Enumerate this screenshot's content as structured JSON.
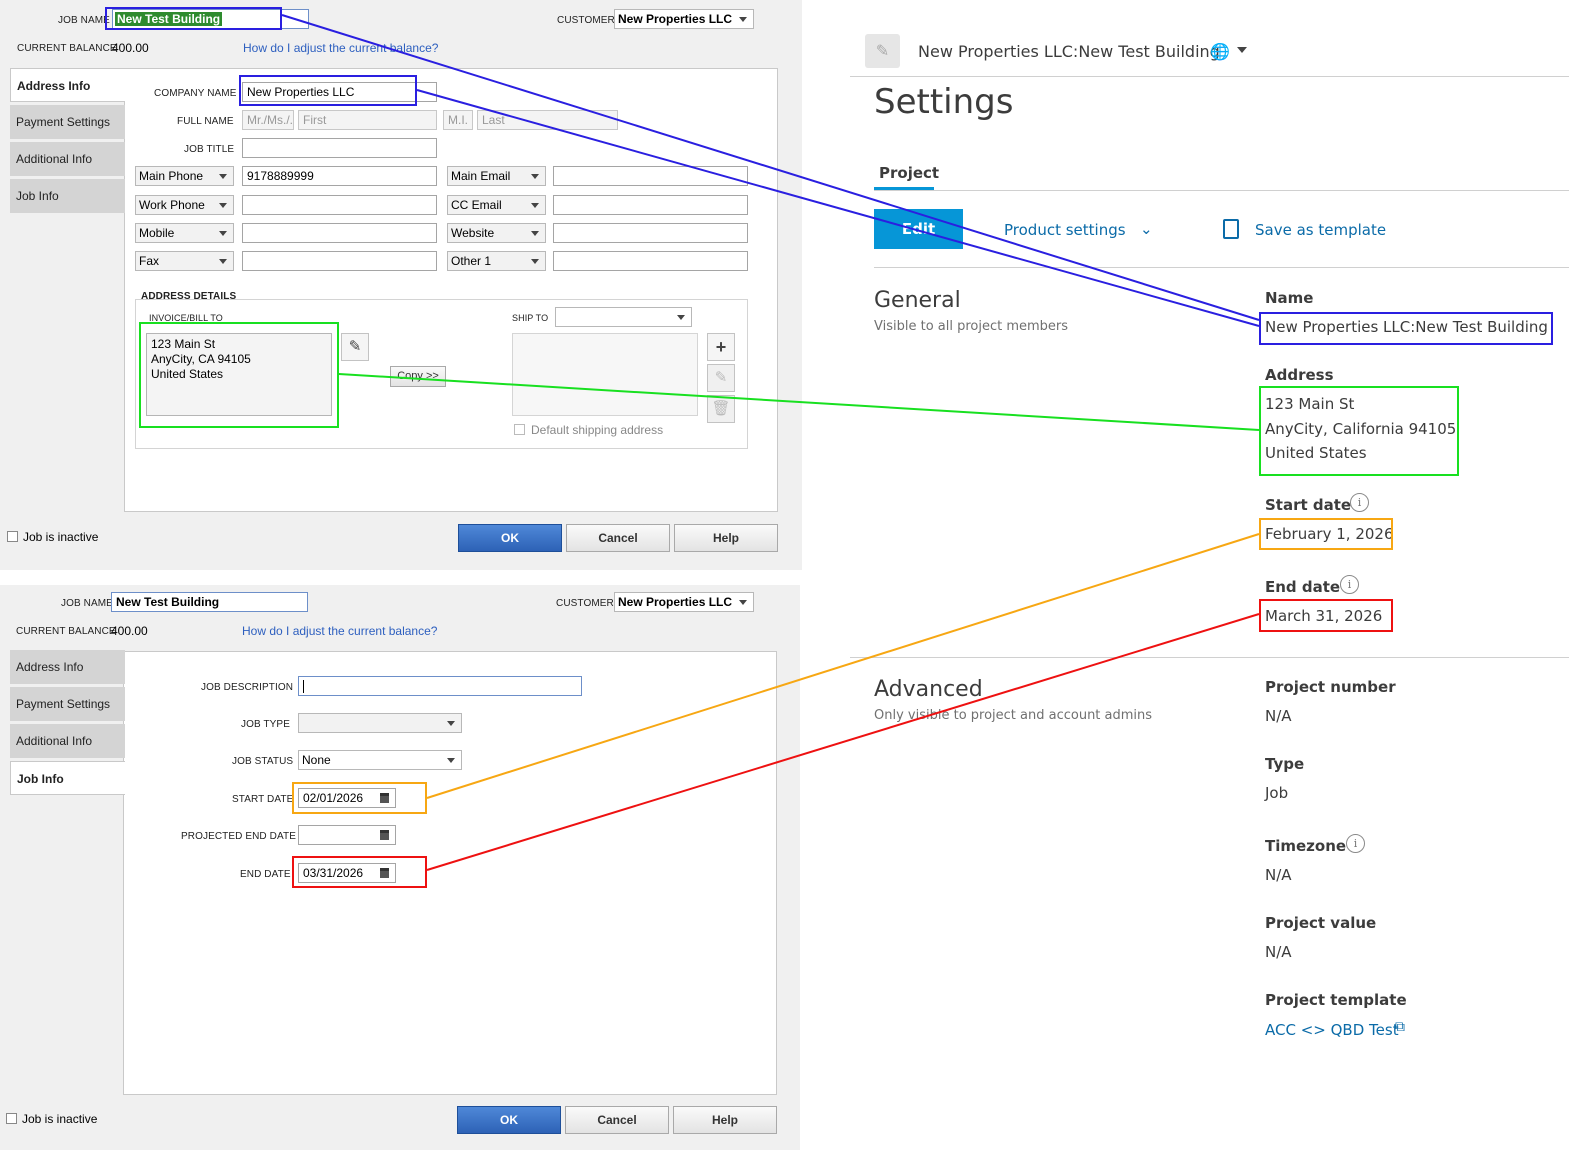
{
  "top_dialog": {
    "job_name_label": "JOB NAME",
    "job_name": "New Test Building",
    "customer_label": "CUSTOMER",
    "customer": "New Properties LLC",
    "balance_label": "CURRENT BALANCE",
    "balance": "400.00",
    "balance_help": "How do I adjust the current balance?",
    "tabs": [
      "Address Info",
      "Payment Settings",
      "Additional Info",
      "Job Info"
    ],
    "company_name_label": "COMPANY NAME",
    "company_name": "New Properties LLC",
    "full_name_label": "FULL NAME",
    "name_placeholders": [
      "Mr./Ms./...",
      "First",
      "M.I.",
      "Last"
    ],
    "job_title_label": "JOB TITLE",
    "phone_rows": [
      {
        "type": "Main Phone",
        "value": "9178889999",
        "type2": "Main Email",
        "value2": ""
      },
      {
        "type": "Work Phone",
        "value": "",
        "type2": "CC Email",
        "value2": ""
      },
      {
        "type": "Mobile",
        "value": "",
        "type2": "Website",
        "value2": ""
      },
      {
        "type": "Fax",
        "value": "",
        "type2": "Other 1",
        "value2": ""
      }
    ],
    "address_details_label": "ADDRESS DETAILS",
    "bill_to_label": "INVOICE/BILL TO",
    "bill_to_lines": [
      "123 Main St",
      "AnyCity, CA 94105",
      "United States"
    ],
    "ship_to_label": "SHIP TO",
    "copy_label": "Copy >>",
    "default_shipping_label": "Default shipping address",
    "inactive_label": "Job is inactive",
    "ok_label": "OK",
    "cancel_label": "Cancel",
    "help_label": "Help"
  },
  "bottom_dialog": {
    "job_name_label": "JOB NAME",
    "job_name": "New Test Building",
    "customer_label": "CUSTOMER",
    "customer": "New Properties LLC",
    "balance_label": "CURRENT BALANCE",
    "balance": "400.00",
    "balance_help": "How do I adjust the current balance?",
    "tabs": [
      "Address Info",
      "Payment Settings",
      "Additional Info",
      "Job Info"
    ],
    "job_description_label": "JOB DESCRIPTION",
    "job_type_label": "JOB TYPE",
    "job_status_label": "JOB STATUS",
    "job_status": "None",
    "start_date_label": "START DATE",
    "start_date": "02/01/2026",
    "projected_end_label": "PROJECTED END DATE",
    "end_date_label": "END DATE",
    "end_date": "03/31/2026",
    "inactive_label": "Job is inactive",
    "ok_label": "OK",
    "cancel_label": "Cancel",
    "help_label": "Help"
  },
  "acc": {
    "project_title": "New Properties LLC:New Test Building",
    "page_title": "Settings",
    "tab_project": "Project",
    "edit_label": "Edit",
    "product_settings_label": "Product settings",
    "save_template_label": "Save as template",
    "general_title": "General",
    "general_sub": "Visible to all project members",
    "name_label": "Name",
    "name_value": "New Properties LLC:New Test Building",
    "address_label": "Address",
    "address_lines": [
      "123 Main St",
      "AnyCity, California 94105",
      "United States"
    ],
    "start_date_label": "Start date",
    "start_date": "February 1, 2026",
    "end_date_label": "End date",
    "end_date": "March 31, 2026",
    "advanced_title": "Advanced",
    "advanced_sub": "Only visible to project and account admins",
    "project_number_label": "Project number",
    "project_number": "N/A",
    "type_label": "Type",
    "type_value": "Job",
    "timezone_label": "Timezone",
    "timezone": "N/A",
    "project_value_label": "Project value",
    "project_value": "N/A",
    "project_template_label": "Project template",
    "project_template": "ACC <> QBD Test",
    "accent_color": "#0696d7",
    "link_color": "#0b6ba8"
  },
  "highlight_colors": {
    "name": "#2a1fe0",
    "address": "#18e020",
    "start": "#f7a713",
    "end": "#ee1111"
  }
}
